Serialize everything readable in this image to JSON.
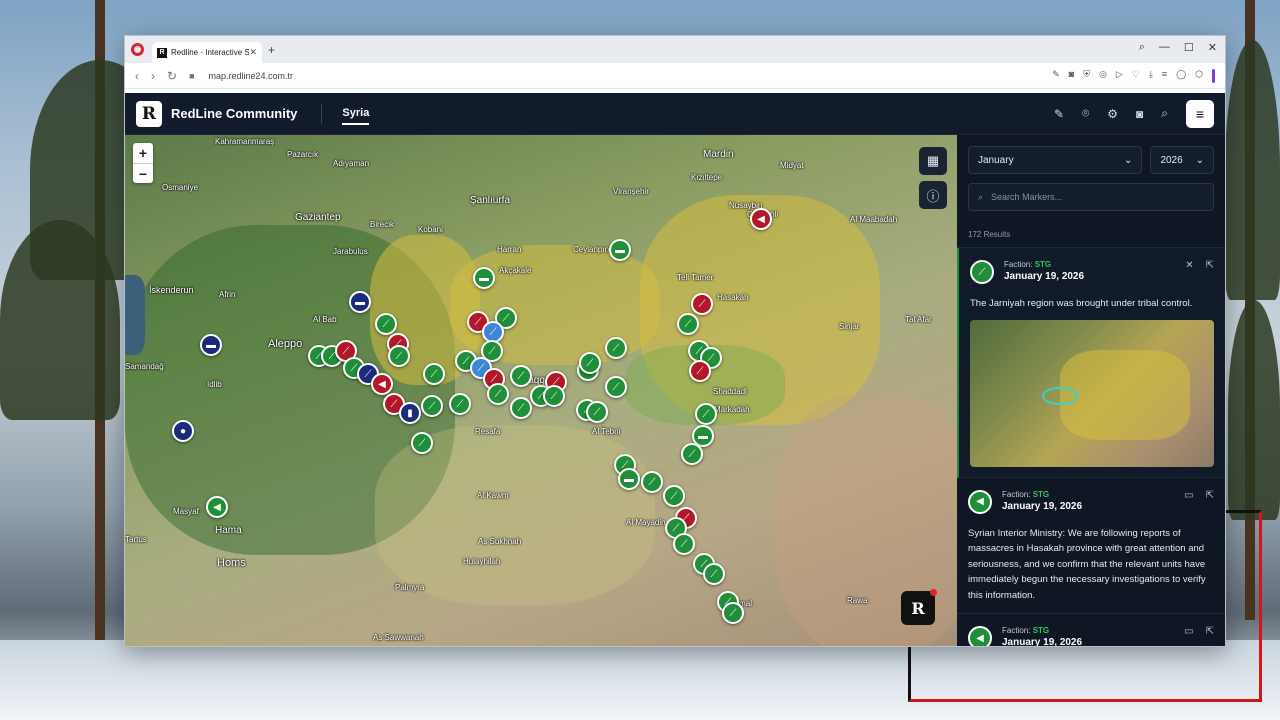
{
  "browser": {
    "tab_title": "Redline - Interactive Strat",
    "url": "map.redline24.com.tr"
  },
  "app": {
    "brand": "RedLine Community",
    "logo_letter": "R",
    "nav_tab": "Syria",
    "zoom_in": "+",
    "zoom_out": "−"
  },
  "sidebar": {
    "month": "January",
    "year": "2026",
    "search_placeholder": "Search Markers...",
    "results_count": "172 Results",
    "cards": [
      {
        "faction_label": "Faction:",
        "faction": "STG",
        "date": "January 19, 2026",
        "text": "The Jarniyah region was brought under tribal control."
      },
      {
        "faction_label": "Faction:",
        "faction": "STG",
        "date": "January 19, 2026",
        "text": "Syrian Interior Ministry: We are following reports of massacres in Hasakah province with great attention and seriousness, and we confirm that the relevant units have immediately begun the necessary investigations to verify this information."
      },
      {
        "faction_label": "Faction:",
        "faction": "STG",
        "date": "January 19, 2026"
      }
    ]
  },
  "map_labels": {
    "kahramanmaras": "Kahramanmaraş",
    "pazarcik": "Pazarcık",
    "adiyaman": "Adıyaman",
    "mardin": "Mardin",
    "midyat": "Midyat",
    "osmaniye": "Osmaniye",
    "gaziantep": "Gaziantep",
    "sanliurfa": "Şanlıurfa",
    "viransehir": "Viranşehir",
    "iskenderun": "İskenderun",
    "aleppo": "Aleppo",
    "raqqah": "Raqqah",
    "hasakah": "Hasakah",
    "homs": "Homs",
    "hama": "Hama",
    "palmyra": "Palmyra",
    "masyaf": "Masyaf",
    "tartus": "Tartus",
    "resafa": "Resafa",
    "al_kawm": "Al Kawm",
    "as_sukhnah": "As Sukhnah",
    "hulayhilah": "Hulayhilah",
    "as_sawwanah": "As Sawwanah",
    "tell_tamer": "Tell Tamer",
    "qamishli": "Qamishli",
    "al_mabadah": "Al Maabadah",
    "samandag": "Samandağ",
    "idlib": "Idlib",
    "afrin": "Afrin",
    "al_bab": "Al Bab",
    "ceylanpinar": "Ceylanpınar",
    "kobani": "Kobani",
    "jarabulus": "Jarabulus",
    "birecik": "Birecik",
    "harran": "Harran",
    "akcakale": "Akçakale",
    "al_tebni": "Al Tebni",
    "al_mayadin": "Al Mayadin",
    "al_kamal": "Al Kamal",
    "rawa": "Rawa",
    "shaddadi": "Shaddadi",
    "markadah": "Markadah",
    "sinjar": "Sinjar",
    "tal_afar": "Tal Afar",
    "nusaybin": "Nusaybin",
    "kiziltepe": "Kızıltepe"
  },
  "colors": {
    "accent_green": "#1f8f3a",
    "faction_green_text": "#34c25a",
    "hostile_red": "#b3182a",
    "navy": "#1b2a7a",
    "app_bg": "#0f1724"
  },
  "icons": {
    "markers": "rifle-icon",
    "vehicle": "truck-icon",
    "announcement": "megaphone-icon"
  }
}
